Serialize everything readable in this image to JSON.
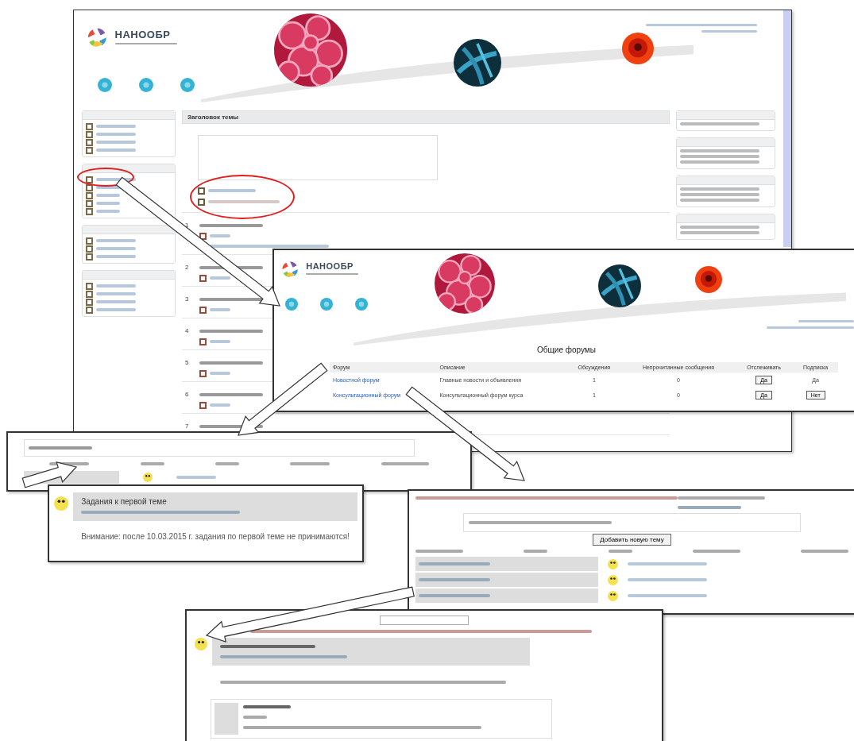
{
  "main_page": {
    "logo": "НАНООБР",
    "topic_header": "Заголовок темы",
    "sections": [
      "1",
      "2",
      "3",
      "4",
      "5",
      "6",
      "7"
    ]
  },
  "forums_page": {
    "logo": "НАНООБР",
    "title": "Общие форумы",
    "columns": [
      "Форум",
      "Описание",
      "Обсуждения",
      "Непрочитанные сообщения",
      "Отслеживать",
      "Подписка"
    ],
    "rows": [
      {
        "forum": "Новостной форум",
        "description": "Главные новости и объявления",
        "discussions": "1",
        "unread": "0",
        "track": "Да",
        "subscription": {
          "label": "Да",
          "kind": "text"
        }
      },
      {
        "forum": "Консультационный форум",
        "description": "Консультационный форум курса",
        "discussions": "1",
        "unread": "0",
        "track": "Да",
        "subscription": {
          "label": "Нет",
          "kind": "button"
        }
      }
    ]
  },
  "post": {
    "title": "Задания к первой теме",
    "body": "Внимание: после 10.03.2015 г. задания по первой теме не принимаются!"
  },
  "discussions_page": {
    "button": "Добавить новую тему"
  }
}
